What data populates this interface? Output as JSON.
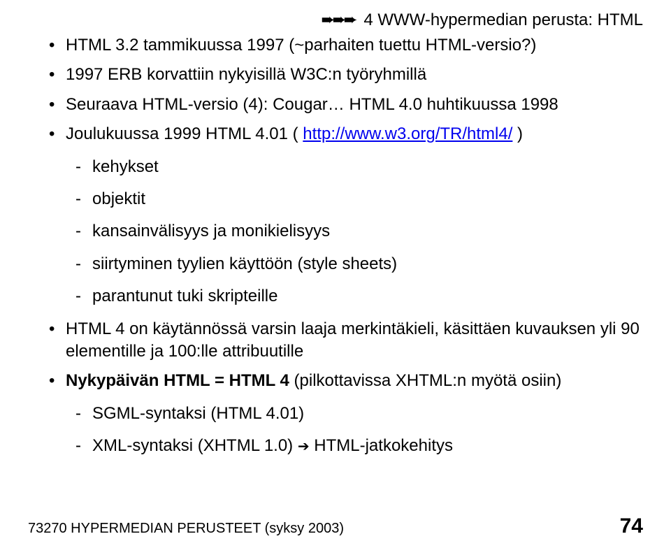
{
  "header": {
    "arrows": "➨➨➨",
    "title": "4 WWW-hypermedian perusta: HTML"
  },
  "bullets": {
    "b1": "HTML 3.2 tammikuussa 1997 (~parhaiten tuettu HTML-versio?)",
    "b2": "1997 ERB korvattiin nykyisillä W3C:n työryhmillä",
    "b3": "Seuraava HTML-versio (4): Cougar… HTML 4.0 huhtikuussa 1998",
    "b4_pre": "Joulukuussa 1999 HTML 4.01 ( ",
    "b4_link": "http://www.w3.org/TR/html4/",
    "b4_post": " )",
    "sub1": "kehykset",
    "sub2": "objektit",
    "sub3": "kansainvälisyys ja monikielisyys",
    "sub4": "siirtyminen tyylien käyttöön (style sheets)",
    "sub5": "parantunut tuki skripteille",
    "b5": "HTML 4 on käytännössä varsin laaja merkintäkieli, käsittäen kuvauksen yli 90 elementille ja 100:lle attribuutille",
    "b6_bold": "Nykypäivän HTML = HTML 4",
    "b6_rest": " (pilkottavissa XHTML:n myötä osiin)",
    "sub6": "SGML-syntaksi (HTML 4.01)",
    "sub7_pre": "XML-syntaksi (XHTML 1.0) ",
    "sub7_arrow": "➔",
    "sub7_post": " HTML-jatkokehitys"
  },
  "footer": {
    "left": "73270 HYPERMEDIAN PERUSTEET (syksy 2003)",
    "right": "74"
  }
}
